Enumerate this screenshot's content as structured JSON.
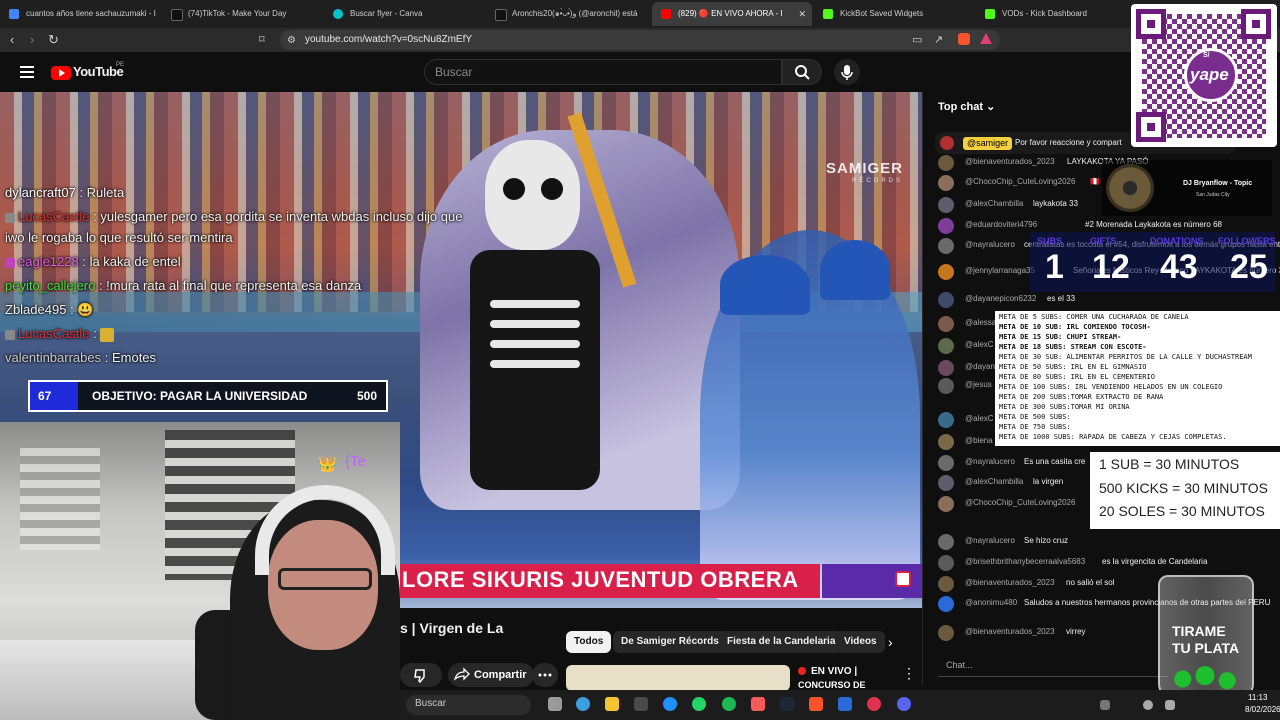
{
  "browser": {
    "tabs": [
      {
        "title": "cuantos años tiene sachauzumaki - I",
        "color": "#4285f4"
      },
      {
        "title": "(74)TikTok - Make Your Day",
        "color": "#111111"
      },
      {
        "title": "Buscar flyer - Canva",
        "color": "#00c4cc"
      },
      {
        "title": "Aronchis20(๑•̀ᴗ•́)و (@aronchil) está",
        "color": "#111111"
      },
      {
        "title": "(829) 🔴 EN VIVO AHORA - I",
        "color": "#ff0000"
      },
      {
        "title": "KickBot Saved Widgets",
        "color": "#53fc18"
      },
      {
        "title": "VODs - Kick Dashboard",
        "color": "#53fc18"
      }
    ],
    "url": "youtube.com/watch?v=0scNu8ZmEfY"
  },
  "youtube": {
    "logo_text": "YouTube",
    "region": "PE",
    "search_placeholder": "Buscar"
  },
  "video": {
    "watermark": "SAMIGER",
    "watermark_sub": "RÉCORDS",
    "banner": "LORE SIKURIS JUVENTUD OBRERA"
  },
  "kick_chat": [
    {
      "user": "dylancraft07",
      "text": " : Ruleta",
      "color": "#ffffff"
    },
    {
      "user": "LucasCastle",
      "text": " : yulesgamer pero esa gordita se inventa wbdas incluso dijo que",
      "color": "#e03030"
    },
    {
      "user": "",
      "text": "iwo le rogaba lo que resultó ser mentira",
      "color": "#ffffff"
    },
    {
      "user": "eagle1228",
      "text": " : la kaka de entel",
      "color": "#e060e0"
    },
    {
      "user": "peyito_callejero",
      "text": " : !mura rata al final que representa esa danza",
      "color": "#40e040"
    },
    {
      "user": "Zblade495",
      "text": " : 😃",
      "color": "#ffffff"
    },
    {
      "user": "LucasCastle",
      "text": " : ",
      "color": "#e03030"
    },
    {
      "user": "valentinbarrabes",
      "text": " : Emotes",
      "color": "#cccccc"
    }
  ],
  "goal": {
    "current": "67",
    "label": "OBJETIVO: PAGAR LA UNIVERSIDAD",
    "target": "500",
    "progress": 0.134
  },
  "webcam": {
    "crown": "👑",
    "tag": "{Te"
  },
  "below": {
    "title": "s | Virgen de La",
    "chips": [
      "Todos",
      "De Samiger Récords",
      "Fiesta de la Candelaria",
      "Videos"
    ],
    "share": "Compartir",
    "live_label": "EN VIVO |",
    "live_sub": "CONCURSO DE"
  },
  "chat": {
    "header": "Top chat",
    "pinned_user": "@samiger",
    "pinned_text": "Por favor reaccione y compart",
    "messages": [
      {
        "user": "@bienaventurados_2023",
        "text": "LAYKAKOTA YA PASÓ"
      },
      {
        "user": "@ChocoChip_CuteLoving2026",
        "text": "🇵🇪"
      },
      {
        "user": "@alexChambilla",
        "text": "laykakota 33"
      },
      {
        "user": "@eduardoviteri4796",
        "text": "#2  Morenada Laykakota es número 68"
      },
      {
        "user": "@nayralucero",
        "text": "centralistas es toccota el #54, disfrutemos a los demás grupos hasta entonces"
      },
      {
        "user": "@jennylarranaga35",
        "text": "Señoriales Místicos Rey Moreno LAYKAKOTA es número 33"
      },
      {
        "user": "@dayanepicon6232",
        "text": "es el 33"
      },
      {
        "user": "@alessa",
        "text": ""
      },
      {
        "user": "@alexC",
        "text": ""
      },
      {
        "user": "@dayan",
        "text": ""
      },
      {
        "user": "@jesus",
        "text": "😋"
      },
      {
        "user": "@alexC",
        "text": ""
      },
      {
        "user": "@biena",
        "text": ""
      },
      {
        "user": "@nayralucero",
        "text": "Es una casita cre"
      },
      {
        "user": "@alexChambilla",
        "text": "la virgen"
      },
      {
        "user": "@ChocoChip_CuteLoving2026",
        "text": "❤️"
      },
      {
        "user": "@nayralucero",
        "text": "Se hizo cruz"
      },
      {
        "user": "@brisethbrithanybecerraalva5683",
        "text": "es la virgencita de Candelaria"
      },
      {
        "user": "@bienaventurados_2023",
        "text": "no salió el sol"
      },
      {
        "user": "@anonimu480",
        "text": "Saludos a nuestros hermanos provincianos de otras partes del PERU"
      },
      {
        "user": "@bienaventurados_2023",
        "text": "virrey"
      }
    ],
    "input_placeholder": "Chat..."
  },
  "overlays": {
    "yape": "yape",
    "yape_mark": "S/",
    "dj_name": "DJ Bryanflow - Topic",
    "dj_sub": "San Judas City",
    "stats": [
      {
        "label": "SUBS",
        "value": "1"
      },
      {
        "label": "GIFTS",
        "value": "12"
      },
      {
        "label": "DONATIONS",
        "value": "43"
      },
      {
        "label": "FOLLOWERS",
        "value": "25"
      }
    ],
    "metas": [
      "META DE 5 SUBS: COMER UNA CUCHARADA DE CANELA",
      "META DE 10 SUB: IRL COMIENDO TOCOSH-",
      "META DE 15 SUB: CHUPI STREAM-",
      "META DE 18 SUBS: STREAM CON ESCOTE-",
      "META DE 30 SUB:  ALIMENTAR PERRITOS DE LA CALLE Y DUCHASTREAM",
      "META DE 50 SUBS: IRL EN EL GIMNASIO",
      "META DE 80 SUBS: IRL EN EL CEMENTERIO",
      "META DE 100 SUBS: IRL VENDIENDO HELADOS EN UN COLEGIO",
      "META DE 200 SUBS:TOMAR EXTRACTO DE RANA",
      "META DE 300 SUBS:TOMAR MI ORINA",
      "META DE 500 SUBS:",
      "META DE 750 SUBS:",
      "META DE 1000 SUBS: RAPADA DE CABEZA Y CEJAS COMPLETAS."
    ],
    "rates": [
      "1 SUB = 30 MINUTOS",
      "500 KICKS = 30 MINUTOS",
      "20 SOLES = 30 MINUTOS"
    ],
    "jar_line1": "TIRAME",
    "jar_line2": "TU PLATA"
  },
  "taskbar": {
    "search": "Buscar",
    "time": "11:13",
    "date": "8/02/2026"
  }
}
